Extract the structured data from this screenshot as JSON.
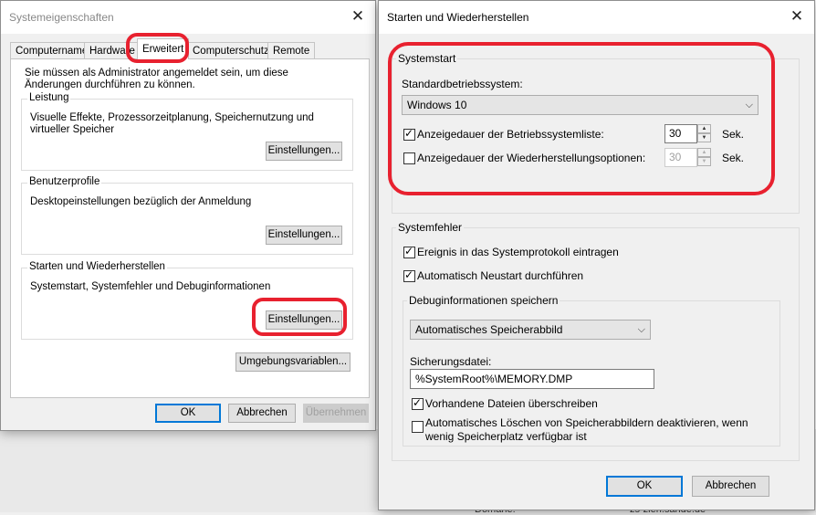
{
  "background": {
    "bottom_text_left": "Domäne:",
    "bottom_text_right": "zs-zieh.sande.de"
  },
  "window1": {
    "title": "Systemeigenschaften",
    "tabs": [
      "Computername",
      "Hardware",
      "Erweitert",
      "Computerschutz",
      "Remote"
    ],
    "active_tab": "Erweitert",
    "admin_note": "Sie müssen als Administrator angemeldet sein, um diese Änderungen durchführen zu können.",
    "groups": [
      {
        "title": "Leistung",
        "description": "Visuelle Effekte, Prozessorzeitplanung, Speichernutzung und virtueller Speicher",
        "button": "Einstellungen..."
      },
      {
        "title": "Benutzerprofile",
        "description": "Desktopeinstellungen bezüglich der Anmeldung",
        "button": "Einstellungen..."
      },
      {
        "title": "Starten und Wiederherstellen",
        "description": "Systemstart, Systemfehler und Debuginformationen",
        "button": "Einstellungen..."
      }
    ],
    "env_button": "Umgebungsvariablen...",
    "ok": "OK",
    "cancel": "Abbrechen",
    "apply": "Übernehmen"
  },
  "window2": {
    "title": "Starten und Wiederherstellen",
    "systemstart": {
      "title": "Systemstart",
      "default_os_label": "Standardbetriebssystem:",
      "default_os_value": "Windows 10",
      "show_os_list": {
        "label": "Anzeigedauer der Betriebssystemliste:",
        "checked": true,
        "value": "30",
        "unit": "Sek."
      },
      "show_recovery": {
        "label": "Anzeigedauer der Wiederherstellungsoptionen:",
        "checked": false,
        "value": "30",
        "unit": "Sek."
      }
    },
    "systemfehler": {
      "title": "Systemfehler",
      "log_event": {
        "label": "Ereignis in das Systemprotokoll eintragen",
        "checked": true
      },
      "auto_restart": {
        "label": "Automatisch Neustart durchführen",
        "checked": true
      },
      "debug": {
        "title": "Debuginformationen speichern",
        "type_value": "Automatisches Speicherabbild",
        "dump_file_label": "Sicherungsdatei:",
        "dump_file_value": "%SystemRoot%\\MEMORY.DMP",
        "overwrite": {
          "label": "Vorhandene Dateien überschreiben",
          "checked": true
        },
        "disable_auto_delete": {
          "label_line1": "Automatisches Löschen von Speicherabbildern deaktivieren, wenn",
          "label_line2": "wenig Speicherplatz verfügbar ist",
          "checked": false
        }
      }
    },
    "ok": "OK",
    "cancel": "Abbrechen"
  },
  "highlight_color": "#e8212f",
  "checkmark": "✓"
}
